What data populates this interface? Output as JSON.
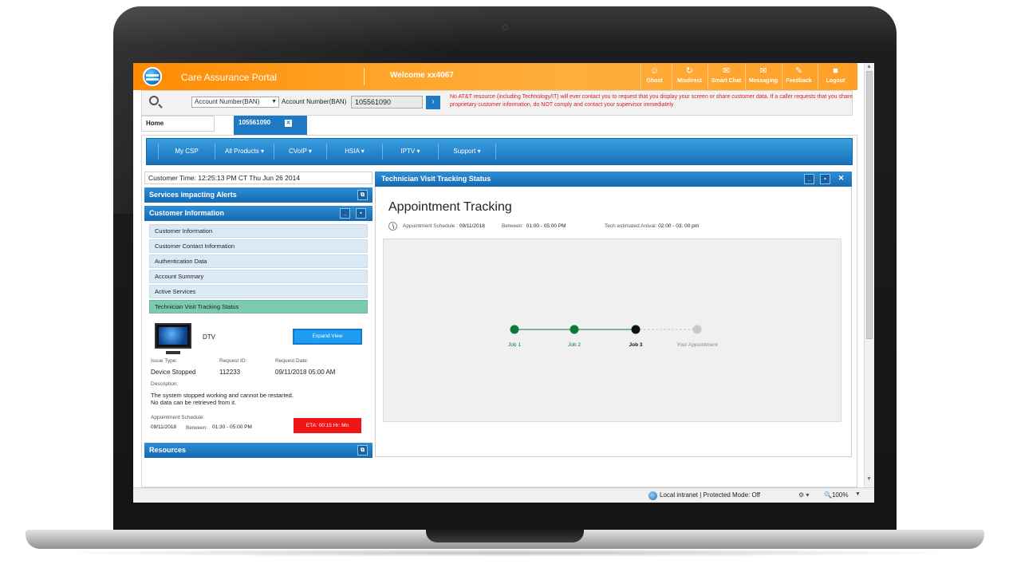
{
  "header": {
    "portal_title": "Care Assurance Portal",
    "welcome": "Welcome xx4067",
    "tools": [
      {
        "label": "Ghost",
        "icon": "ghost-icon"
      },
      {
        "label": "Misdirect",
        "icon": "misdirect-icon"
      },
      {
        "label": "Smart Chat",
        "icon": "chat-icon"
      },
      {
        "label": "Messaging",
        "icon": "mail-icon"
      },
      {
        "label": "Feedback",
        "icon": "pencil-icon"
      },
      {
        "label": "Logout",
        "icon": "lock-icon"
      }
    ]
  },
  "search": {
    "type_select": "Account Number(BAN)",
    "field_label": "Account Number(BAN)",
    "value": "105561090",
    "warning": "No AT&T resource (including Technology/IT) will ever contact you to request that you display your screen or share customer data. If a caller requests that you share proprietary customer information, do NOT comply and contact your supervisor immediately"
  },
  "tabs": {
    "home": "Home",
    "account": "105561090"
  },
  "menu": [
    "My CSP",
    "All Products ▾",
    "CVoIP ▾",
    "HSIA ▾",
    "IPTV ▾",
    "Support ▾"
  ],
  "left": {
    "customer_time": "Customer Time: 12:25:13 PM CT Thu Jun 26 2014",
    "alerts_title": "Services impacting Alerts",
    "info_title": "Customer  Information",
    "nav": [
      "Customer Information",
      "Customer Contact Information",
      "Authentication Data",
      "Account Summary",
      "Active Services",
      "Technician Visit Tracking Status"
    ],
    "device": {
      "name": "DTV",
      "expand_label": "Expand View",
      "issue_type_label": "Issue Type:",
      "issue_type": "Device Stopped",
      "request_id_label": "Request ID:",
      "request_id": "112233",
      "request_date_label": "Request Date:",
      "request_date": "09/11/2018  05:00 AM",
      "description_label": "Description:",
      "description_line1": "The system stopped working and cannot be restarted.",
      "description_line2": "No data can be retrieved from it.",
      "schedule_label": "Appointment Schedule:",
      "schedule_date": "09/11/2018",
      "between_label": "Between:",
      "schedule_between": "01:30 -  05:00 PM",
      "eta": "ETA: 00:15  Hr: Mn"
    },
    "resources_title": "Resources"
  },
  "right": {
    "panel_title": "Technician Visit Tracking Status",
    "appt_title": "Appointment Tracking",
    "schedule_label": "Appointment Schedule : ",
    "schedule_date": "09/11/2018",
    "between_label": "Between:",
    "between_value": "01:00 -  05:00 PM",
    "arrival_label": "Tech estimated  Arrival: ",
    "arrival_value": "02:00 - 03: 00 pm",
    "steps": [
      {
        "label": "Job 1",
        "state": "done"
      },
      {
        "label": "Job 2",
        "state": "done"
      },
      {
        "label": "Job 3",
        "state": "current"
      },
      {
        "label": "Your Appointment",
        "state": "pending"
      }
    ],
    "colors": {
      "done": "#0a7a3c",
      "current": "#111111",
      "pending": "#c8c8c8"
    }
  },
  "statusbar": {
    "zone": "Local intranet | Protected Mode: Off",
    "zoom": "100%"
  }
}
